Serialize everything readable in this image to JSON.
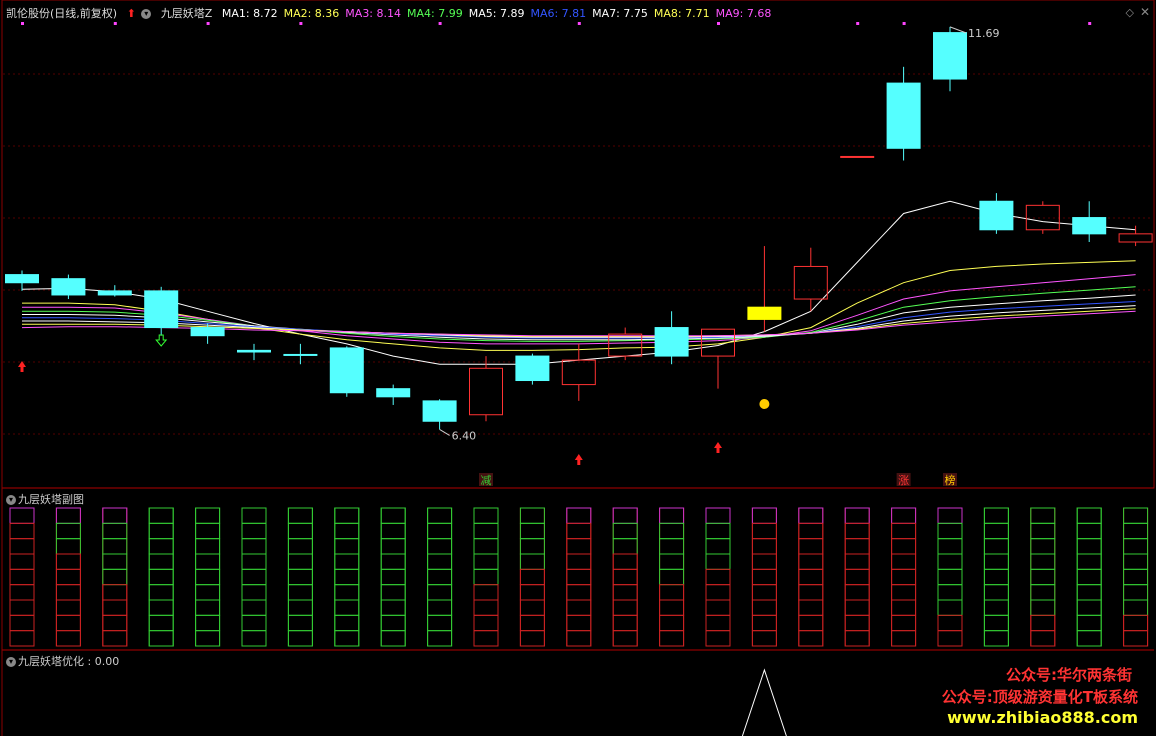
{
  "header": {
    "stock_label": "凯伦股份(日线,前复权)",
    "indicator_name": "九层妖塔Z",
    "ma_items": [
      {
        "text": "MA1: 8.72",
        "color": "#ffffff"
      },
      {
        "text": "MA2: 8.36",
        "color": "#ffff55"
      },
      {
        "text": "MA3: 8.14",
        "color": "#ff55ff"
      },
      {
        "text": "MA4: 7.99",
        "color": "#55ff55"
      },
      {
        "text": "MA5: 7.89",
        "color": "#ffffff"
      },
      {
        "text": "MA6: 7.81",
        "color": "#3355ff"
      },
      {
        "text": "MA7: 7.75",
        "color": "#ffffff"
      },
      {
        "text": "MA8: 7.71",
        "color": "#ffff55"
      },
      {
        "text": "MA9: 7.68",
        "color": "#ff55ff"
      }
    ]
  },
  "sub_panel_title": "九层妖塔副图",
  "bottom_panel_title": "九层妖塔优化",
  "bottom_panel_value": ": 0.00",
  "watermarks": [
    {
      "text": "公众号:华尔两条街",
      "color": "#ff3333"
    },
    {
      "text": "公众号:顶级游资量化T板系统",
      "color": "#ff3333"
    },
    {
      "text": "www.zhibiao888.com",
      "color": "#ffff33"
    }
  ],
  "chart_data": {
    "type": "candlestick",
    "high_label": "11.69",
    "low_label": "6.40",
    "markers": [
      {
        "index": 10,
        "text": "减",
        "color": "#33cc33"
      },
      {
        "index": 19,
        "text": "涨",
        "color": "#ff3333"
      },
      {
        "index": 20,
        "text": "榜",
        "color": "#ffcc00"
      }
    ],
    "candles": [
      {
        "o": 8.65,
        "c": 8.55,
        "h": 8.7,
        "l": 8.45
      },
      {
        "o": 8.6,
        "c": 8.4,
        "h": 8.65,
        "l": 8.35
      },
      {
        "o": 8.45,
        "c": 8.4,
        "h": 8.52,
        "l": 8.38
      },
      {
        "o": 8.45,
        "c": 8.0,
        "h": 8.5,
        "l": 7.9
      },
      {
        "o": 8.0,
        "c": 7.9,
        "h": 8.05,
        "l": 7.8
      },
      {
        "o": 7.72,
        "c": 7.7,
        "h": 7.8,
        "l": 7.6
      },
      {
        "o": 7.67,
        "c": 7.66,
        "h": 7.8,
        "l": 7.55
      },
      {
        "o": 7.75,
        "c": 7.2,
        "h": 7.77,
        "l": 7.15
      },
      {
        "o": 7.25,
        "c": 7.15,
        "h": 7.3,
        "l": 7.05
      },
      {
        "o": 7.1,
        "c": 6.85,
        "h": 7.12,
        "l": 6.75
      },
      {
        "o": 6.93,
        "c": 7.5,
        "h": 7.65,
        "l": 6.85
      },
      {
        "o": 7.65,
        "c": 7.35,
        "h": 7.68,
        "l": 7.3
      },
      {
        "o": 7.3,
        "c": 7.6,
        "h": 7.8,
        "l": 7.1
      },
      {
        "o": 7.65,
        "c": 7.92,
        "h": 8.0,
        "l": 7.6
      },
      {
        "o": 8.0,
        "c": 7.65,
        "h": 8.2,
        "l": 7.55
      },
      {
        "o": 7.65,
        "c": 7.98,
        "h": 7.98,
        "l": 7.25
      },
      {
        "o": 8.1,
        "c": 8.25,
        "h": 9.0,
        "l": 7.95
      },
      {
        "o": 8.35,
        "c": 8.75,
        "h": 8.98,
        "l": 8.2
      },
      {
        "o": 10.1,
        "c": 10.1,
        "h": 10.1,
        "l": 10.1
      },
      {
        "o": 11.0,
        "c": 10.2,
        "h": 11.2,
        "l": 10.05
      },
      {
        "o": 11.62,
        "c": 11.05,
        "h": 11.69,
        "l": 10.9
      },
      {
        "o": 9.55,
        "c": 9.2,
        "h": 9.65,
        "l": 9.15
      },
      {
        "o": 9.2,
        "c": 9.5,
        "h": 9.55,
        "l": 9.15
      },
      {
        "o": 9.35,
        "c": 9.15,
        "h": 9.55,
        "l": 9.05
      },
      {
        "o": 9.05,
        "c": 9.15,
        "h": 9.25,
        "l": 9.0
      }
    ],
    "ma_lines": [
      {
        "name": "MA1",
        "color": "#ffffff",
        "values": [
          8.47,
          8.48,
          8.44,
          8.35,
          8.2,
          8.05,
          7.92,
          7.8,
          7.65,
          7.55,
          7.55,
          7.55,
          7.6,
          7.65,
          7.7,
          7.78,
          7.95,
          8.2,
          8.8,
          9.4,
          9.55,
          9.4,
          9.3,
          9.25,
          9.2
        ]
      },
      {
        "name": "MA2",
        "color": "#ffff55",
        "values": [
          8.3,
          8.3,
          8.28,
          8.2,
          8.1,
          8.0,
          7.92,
          7.85,
          7.8,
          7.75,
          7.72,
          7.72,
          7.73,
          7.75,
          7.76,
          7.8,
          7.88,
          8.0,
          8.3,
          8.55,
          8.7,
          8.75,
          8.78,
          8.8,
          8.82
        ]
      },
      {
        "name": "MA3",
        "color": "#ff55ff",
        "values": [
          8.25,
          8.25,
          8.24,
          8.18,
          8.1,
          8.02,
          7.96,
          7.9,
          7.86,
          7.82,
          7.8,
          7.8,
          7.8,
          7.81,
          7.82,
          7.84,
          7.88,
          7.96,
          8.15,
          8.35,
          8.45,
          8.5,
          8.55,
          8.6,
          8.65
        ]
      },
      {
        "name": "MA4",
        "color": "#55ff55",
        "values": [
          8.2,
          8.2,
          8.19,
          8.15,
          8.09,
          8.02,
          7.97,
          7.93,
          7.89,
          7.86,
          7.84,
          7.83,
          7.83,
          7.84,
          7.85,
          7.86,
          7.88,
          7.94,
          8.08,
          8.25,
          8.33,
          8.38,
          8.42,
          8.46,
          8.5
        ]
      },
      {
        "name": "MA5",
        "color": "#ffffff",
        "values": [
          8.16,
          8.16,
          8.15,
          8.12,
          8.07,
          8.02,
          7.98,
          7.94,
          7.91,
          7.88,
          7.86,
          7.85,
          7.85,
          7.85,
          7.86,
          7.87,
          7.89,
          7.93,
          8.04,
          8.18,
          8.25,
          8.29,
          8.33,
          8.36,
          8.4
        ]
      },
      {
        "name": "MA6",
        "color": "#3355ff",
        "values": [
          8.12,
          8.12,
          8.11,
          8.09,
          8.05,
          8.01,
          7.98,
          7.95,
          7.92,
          7.9,
          7.88,
          7.87,
          7.87,
          7.87,
          7.87,
          7.88,
          7.9,
          7.93,
          8.01,
          8.12,
          8.19,
          8.23,
          8.26,
          8.29,
          8.32
        ]
      },
      {
        "name": "MA7",
        "color": "#ffffff",
        "values": [
          8.08,
          8.08,
          8.07,
          8.06,
          8.03,
          8.0,
          7.97,
          7.95,
          7.93,
          7.91,
          7.89,
          7.88,
          7.88,
          7.88,
          7.88,
          7.89,
          7.9,
          7.93,
          7.99,
          8.08,
          8.14,
          8.18,
          8.21,
          8.24,
          8.27
        ]
      },
      {
        "name": "MA8",
        "color": "#ffff55",
        "values": [
          8.04,
          8.04,
          8.04,
          8.03,
          8.01,
          7.99,
          7.97,
          7.95,
          7.93,
          7.92,
          7.9,
          7.89,
          7.89,
          7.89,
          7.89,
          7.9,
          7.91,
          7.93,
          7.98,
          8.05,
          8.1,
          8.14,
          8.17,
          8.2,
          8.23
        ]
      },
      {
        "name": "MA9",
        "color": "#ff55ff",
        "values": [
          8.0,
          8.01,
          8.01,
          8.0,
          7.99,
          7.97,
          7.96,
          7.95,
          7.93,
          7.92,
          7.91,
          7.9,
          7.9,
          7.9,
          7.9,
          7.9,
          7.91,
          7.93,
          7.97,
          8.03,
          8.07,
          8.11,
          8.14,
          8.17,
          8.2
        ]
      }
    ],
    "towers": [
      {
        "magenta": 1,
        "green": 0,
        "red": 8
      },
      {
        "magenta": 1,
        "green": 2,
        "red": 6
      },
      {
        "magenta": 1,
        "green": 4,
        "red": 4
      },
      {
        "magenta": 0,
        "green": 9,
        "red": 0
      },
      {
        "magenta": 0,
        "green": 9,
        "red": 0
      },
      {
        "magenta": 0,
        "green": 9,
        "red": 0
      },
      {
        "magenta": 0,
        "green": 9,
        "red": 0
      },
      {
        "magenta": 0,
        "green": 9,
        "red": 0
      },
      {
        "magenta": 0,
        "green": 9,
        "red": 0
      },
      {
        "magenta": 0,
        "green": 9,
        "red": 0
      },
      {
        "magenta": 0,
        "green": 5,
        "red": 4
      },
      {
        "magenta": 0,
        "green": 4,
        "red": 5
      },
      {
        "magenta": 1,
        "green": 0,
        "red": 8
      },
      {
        "magenta": 1,
        "green": 2,
        "red": 6
      },
      {
        "magenta": 1,
        "green": 4,
        "red": 4
      },
      {
        "magenta": 1,
        "green": 3,
        "red": 5
      },
      {
        "magenta": 1,
        "green": 0,
        "red": 8
      },
      {
        "magenta": 1,
        "green": 0,
        "red": 8
      },
      {
        "magenta": 1,
        "green": 0,
        "red": 8
      },
      {
        "magenta": 1,
        "green": 0,
        "red": 8
      },
      {
        "magenta": 1,
        "green": 6,
        "red": 2
      },
      {
        "magenta": 0,
        "green": 9,
        "red": 0
      },
      {
        "magenta": 0,
        "green": 7,
        "red": 2
      },
      {
        "magenta": 0,
        "green": 9,
        "red": 0
      },
      {
        "magenta": 0,
        "green": 7,
        "red": 2
      }
    ],
    "bottom_spike": {
      "index": 16,
      "value": 1
    }
  }
}
